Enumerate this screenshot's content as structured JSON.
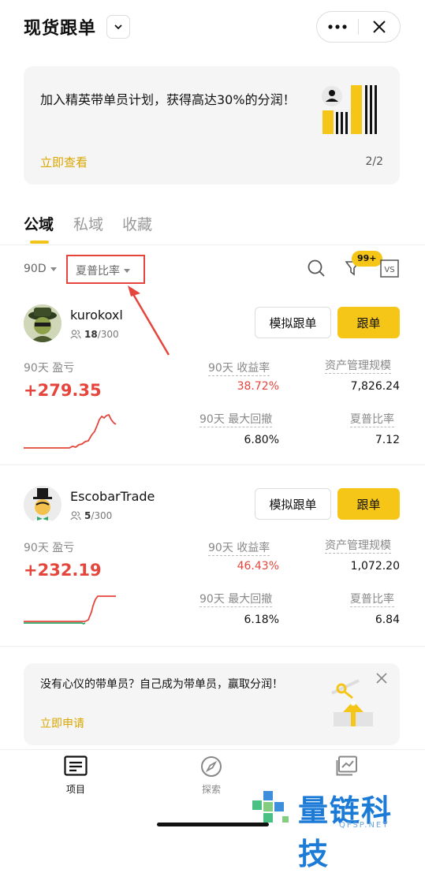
{
  "header": {
    "title": "现货跟单"
  },
  "banner": {
    "text": "加入精英带单员计划，获得高达30%的分润！",
    "link": "立即查看",
    "page": "2/2"
  },
  "tabs": [
    {
      "label": "公域",
      "active": true
    },
    {
      "label": "私域",
      "active": false
    },
    {
      "label": "收藏",
      "active": false
    }
  ],
  "filters": {
    "period": "90D",
    "sort": "夏普比率",
    "badge": "99+",
    "vs_icon": "vs-compare-icon"
  },
  "traders": [
    {
      "name": "kurokoxl",
      "followers": "18",
      "capacity": "/300",
      "pnl_label": "90天 盈亏",
      "pnl": "+279.35",
      "roi_label": "90天 收益率",
      "roi": "38.72%",
      "aum_label": "资产管理规模",
      "aum": "7,826.24",
      "mdd_label": "90天 最大回撤",
      "mdd": "6.80%",
      "sharpe_label": "夏普比率",
      "sharpe": "7.12",
      "sim_button": "模拟跟单",
      "follow_button": "跟单"
    },
    {
      "name": "EscobarTrade",
      "followers": "5",
      "capacity": "/300",
      "pnl_label": "90天 盈亏",
      "pnl": "+232.19",
      "roi_label": "90天 收益率",
      "roi": "46.43%",
      "aum_label": "资产管理规模",
      "aum": "1,072.20",
      "mdd_label": "90天 最大回撤",
      "mdd": "6.18%",
      "sharpe_label": "夏普比率",
      "sharpe": "6.84",
      "sim_button": "模拟跟单",
      "follow_button": "跟单"
    }
  ],
  "promo": {
    "text": "没有心仪的带单员？自己成为带单员，赢取分润！",
    "link": "立即申请"
  },
  "nav": [
    {
      "label": "项目",
      "icon": "list-icon",
      "active": true
    },
    {
      "label": "探索",
      "icon": "compass-icon",
      "active": false
    },
    {
      "label": "",
      "icon": "chart-icon",
      "active": false
    }
  ],
  "watermark": {
    "text": "量链科技",
    "url": "QFSP.NET"
  },
  "colors": {
    "accent": "#f5c518",
    "profit": "#e5453c",
    "link": "#d9a600"
  }
}
